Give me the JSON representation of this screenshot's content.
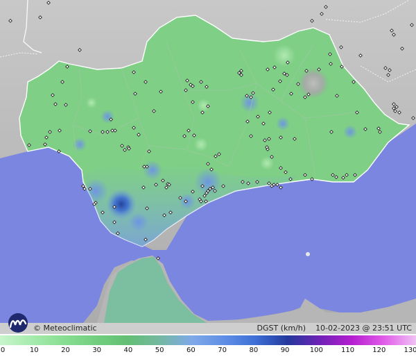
{
  "colors": {
    "sea": "#7b86e0",
    "land_outside": "#b4b4b4",
    "andalusia": "#7fcf86",
    "calm_green": "#6fc47a",
    "blue_gust": "#6f9ce0",
    "dark_gust": "#2a52b0",
    "peak_gray": "#b8b8b8"
  },
  "brand": {
    "name": "© Meteoclimatic",
    "logo_icon": "meteoclimatic-logo-icon"
  },
  "info": {
    "variable": "DGST (km/h)",
    "timestamp": "10-02-2023 @ 23:51 UTC"
  },
  "legend": {
    "ticks": [
      "0",
      "10",
      "20",
      "30",
      "40",
      "50",
      "60",
      "70",
      "80",
      "90",
      "100",
      "110",
      "120",
      "130"
    ],
    "values": [
      0,
      10,
      20,
      30,
      40,
      50,
      60,
      70,
      80,
      90,
      100,
      110,
      120,
      130
    ],
    "colors": [
      "#c8f5cc",
      "#a6ebad",
      "#88de92",
      "#72cf7f",
      "#63be74",
      "#74b8a2",
      "#7fa9e8",
      "#5f8fe6",
      "#3d6fd6",
      "#24389c",
      "#6f22b6",
      "#b51ed0",
      "#e05ce8",
      "#f0c2f4"
    ]
  }
}
